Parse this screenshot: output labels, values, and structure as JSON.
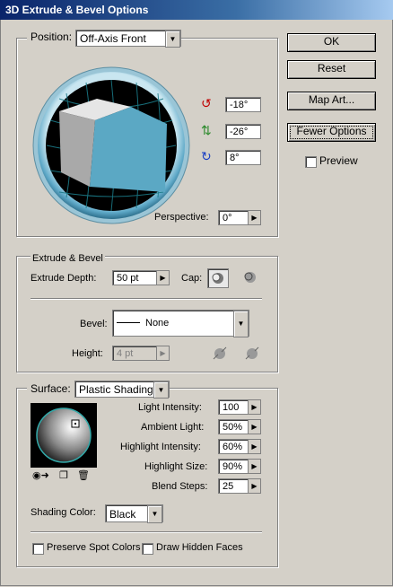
{
  "window": {
    "title": "3D Extrude & Bevel Options"
  },
  "buttons": {
    "ok": "OK",
    "reset": "Reset",
    "map_art": "Map Art...",
    "fewer_options": "Fewer Options"
  },
  "preview": {
    "label": "Preview",
    "checked": false
  },
  "position": {
    "label": "Position:",
    "preset": "Off-Axis Front",
    "rotate_x": "-18°",
    "rotate_y": "-26°",
    "rotate_z": "8°",
    "perspective_label": "Perspective:",
    "perspective_value": "0°"
  },
  "extrude": {
    "section_title": "Extrude & Bevel",
    "depth_label": "Extrude Depth:",
    "depth_value": "50 pt",
    "cap_label": "Cap:",
    "bevel_label": "Bevel:",
    "bevel_value": "None",
    "height_label": "Height:",
    "height_value": "4 pt"
  },
  "surface": {
    "label": "Surface:",
    "value": "Plastic Shading",
    "light_intensity_label": "Light Intensity:",
    "light_intensity": "100",
    "ambient_light_label": "Ambient Light:",
    "ambient_light": "50%",
    "highlight_intensity_label": "Highlight Intensity:",
    "highlight_intensity": "60%",
    "highlight_size_label": "Highlight Size:",
    "highlight_size": "90%",
    "blend_steps_label": "Blend Steps:",
    "blend_steps": "25",
    "shading_color_label": "Shading Color:",
    "shading_color": "Black",
    "preserve_spot_label": "Preserve Spot Colors",
    "draw_hidden_label": "Draw Hidden Faces"
  },
  "colors": {
    "cube_front": "#5ba8c4",
    "cube_side": "#a9a9a9",
    "cube_top": "#e6e6e6",
    "titlebar": "#0a246a",
    "dialog": "#d4d0c8"
  }
}
